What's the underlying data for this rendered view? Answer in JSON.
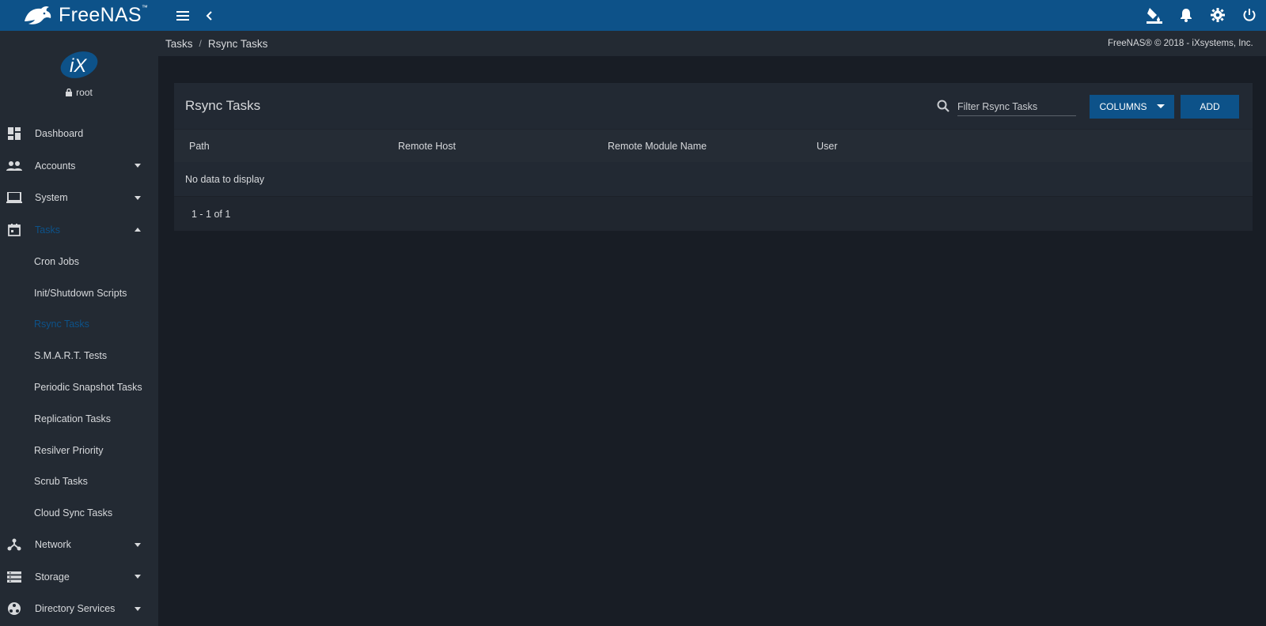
{
  "brand": {
    "name": "FreeNAS",
    "mark": "™"
  },
  "user": {
    "name": "root"
  },
  "breadcrumb": {
    "parent": "Tasks",
    "separator": "/",
    "current": "Rsync Tasks"
  },
  "copyright": "FreeNAS® © 2018 - iXsystems, Inc.",
  "nav": {
    "dashboard": "Dashboard",
    "accounts": "Accounts",
    "system": "System",
    "tasks": "Tasks",
    "network": "Network",
    "storage": "Storage",
    "directory_services": "Directory Services",
    "tasks_sub": [
      "Cron Jobs",
      "Init/Shutdown Scripts",
      "Rsync Tasks",
      "S.M.A.R.T. Tests",
      "Periodic Snapshot Tasks",
      "Replication Tasks",
      "Resilver Priority",
      "Scrub Tasks",
      "Cloud Sync Tasks"
    ],
    "active_sub": "Rsync Tasks"
  },
  "card": {
    "title": "Rsync Tasks",
    "filter_placeholder": "Filter Rsync Tasks",
    "columns_label": "COLUMNS",
    "add_label": "ADD",
    "headers": [
      "Path",
      "Remote Host",
      "Remote Module Name",
      "User"
    ],
    "empty": "No data to display",
    "pager": "1 - 1 of 1"
  },
  "colors": {
    "primary": "#0d5289",
    "sidebar": "#232a33",
    "background": "#181d25"
  },
  "icons": [
    "menu-icon",
    "chevron-left-icon",
    "theme-paint-icon",
    "bell-icon",
    "settings-gear-icon",
    "power-icon",
    "lock-icon",
    "search-icon"
  ]
}
